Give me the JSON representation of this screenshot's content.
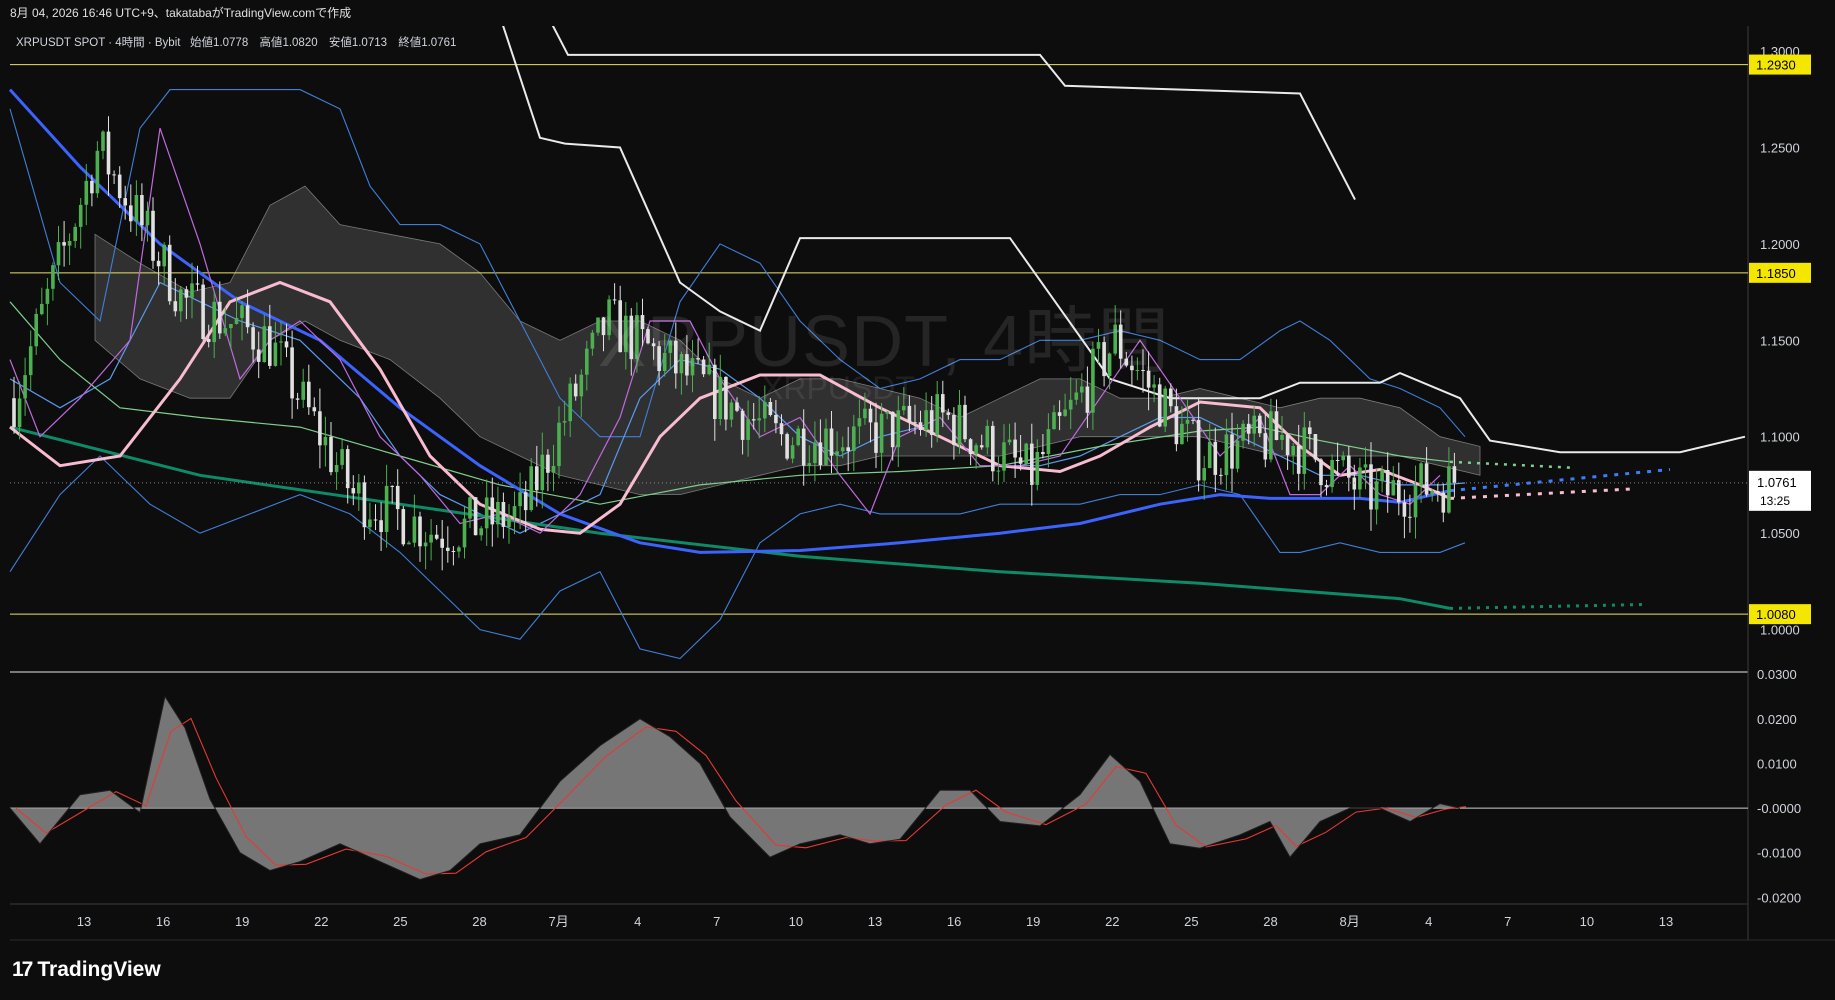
{
  "header": {
    "meta_text": "8月 04, 2026 16:46 UTC+9、takatabaがTradingView.comで作成"
  },
  "legend": {
    "symbol": "XRPUSDT SPOT · 4時間 · Bybit",
    "open_label": "始値",
    "open": "1.0778",
    "high_label": "高値",
    "high": "1.0820",
    "low_label": "安値",
    "low": "1.0713",
    "close_label": "終値",
    "close": "1.0761"
  },
  "watermark": {
    "main": "XRPUSDT, 4時間",
    "sub": "XRPUSDT"
  },
  "price_axis": {
    "ticks": [
      "1.3000",
      "1.2500",
      "1.2000",
      "1.1500",
      "1.1000",
      "1.0500",
      "1.0000"
    ],
    "levels": [
      {
        "value": 1.293,
        "label": "1.2930"
      },
      {
        "value": 1.185,
        "label": "1.1850"
      },
      {
        "value": 1.008,
        "label": "1.0080"
      }
    ],
    "current": {
      "value": 1.0761,
      "label": "1.0761",
      "countdown": "13:25"
    }
  },
  "osc_axis": {
    "ticks": [
      "0.0300",
      "0.0200",
      "0.0100",
      "-0.0000",
      "-0.0100",
      "-0.0200"
    ]
  },
  "time_axis": {
    "labels": [
      "13",
      "16",
      "19",
      "22",
      "25",
      "28",
      "7月",
      "4",
      "7",
      "10",
      "13",
      "16",
      "19",
      "22",
      "25",
      "28",
      "8月",
      "4",
      "7",
      "10",
      "13"
    ]
  },
  "branding": {
    "name": "TradingView",
    "logo": "17"
  },
  "colors": {
    "background": "#0d0d0d",
    "level_line": "#e8e36a",
    "level_badge": "#f5e600",
    "candle_up": "#4caf50",
    "candle_down": "#e0e0e0",
    "ma_short": "#3d63ff",
    "ma_long": "#0f8a66",
    "ma_pink": "#f8bbd0",
    "bollinger": "#3f7fd9",
    "ichimoku_cloud": "#5a5a5a",
    "osc_hist": "#8a8a8a",
    "osc_signal": "#e53935"
  },
  "chart_data": {
    "type": "candlestick",
    "symbol": "XRPUSDT",
    "timeframe": "4時間",
    "ylim": [
      0.978,
      1.313
    ],
    "horizontal_levels": [
      1.293,
      1.185,
      1.008
    ],
    "closes_by_day": [
      {
        "day": "13",
        "close": 1.12
      },
      {
        "day": "16",
        "close": 1.25
      },
      {
        "day": "19",
        "close": 1.17
      },
      {
        "day": "22",
        "close": 1.15
      },
      {
        "day": "25",
        "close": 1.07
      },
      {
        "day": "28",
        "close": 1.05
      },
      {
        "day": "7月",
        "close": 1.06
      },
      {
        "day": "4",
        "close": 1.16
      },
      {
        "day": "7",
        "close": 1.13
      },
      {
        "day": "10",
        "close": 1.1
      },
      {
        "day": "13",
        "close": 1.1
      },
      {
        "day": "16",
        "close": 1.11
      },
      {
        "day": "19",
        "close": 1.08
      },
      {
        "day": "22",
        "close": 1.15
      },
      {
        "day": "25",
        "close": 1.09
      },
      {
        "day": "28",
        "close": 1.1
      },
      {
        "day": "8月",
        "close": 1.07
      },
      {
        "day": "4",
        "close": 1.0761
      }
    ],
    "oscillator": {
      "ylim": [
        -0.0215,
        0.0305
      ],
      "zero": 0.0,
      "peaks": [
        0.025,
        -0.016,
        0.02,
        -0.011,
        0.012,
        -0.011,
        0.001
      ]
    }
  }
}
